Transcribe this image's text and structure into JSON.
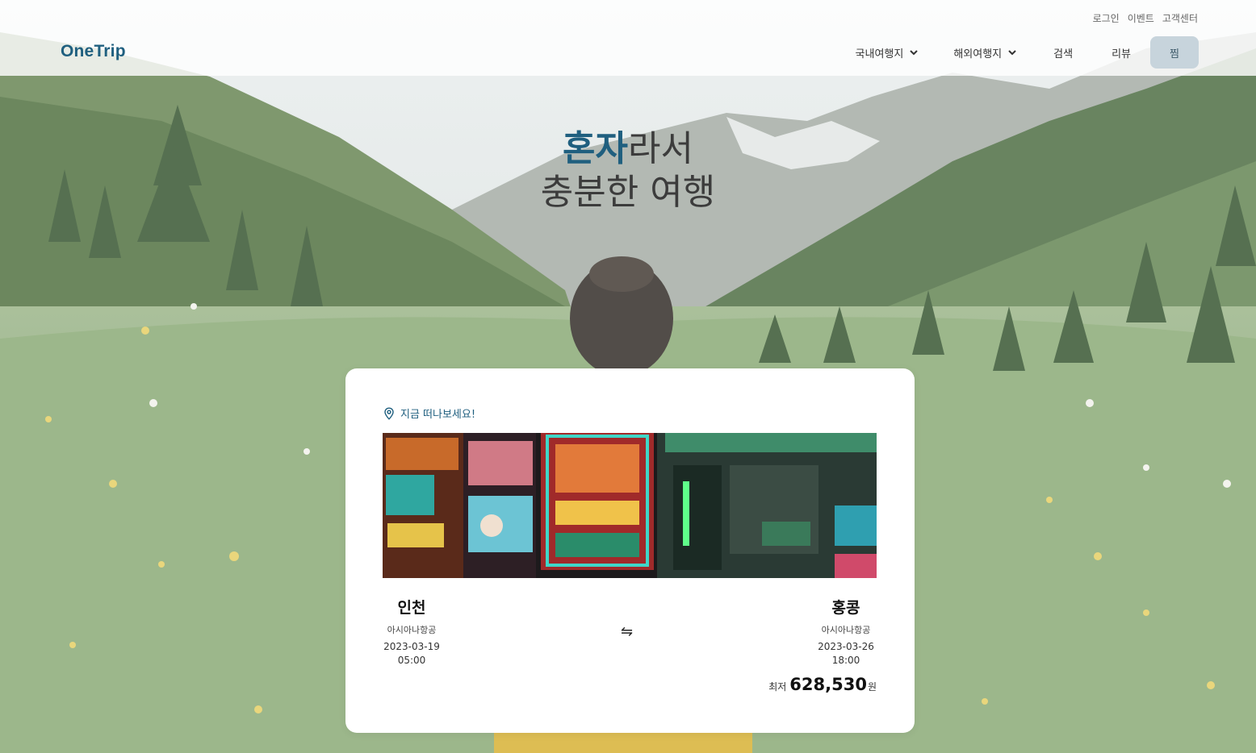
{
  "header": {
    "logo": "OneTrip",
    "utility": [
      "로그인",
      "이벤트",
      "고객센터"
    ],
    "nav": {
      "domestic": "국내여행지",
      "overseas": "해외여행지",
      "search": "검색",
      "review": "리뷰",
      "wishlist": "찜"
    }
  },
  "hero": {
    "line1_accent": "혼자",
    "line1_rest": "라서",
    "line2": "충분한 여행"
  },
  "card": {
    "label": "지금 떠나보세요!",
    "from": {
      "city": "인천",
      "airline": "아시아나항공",
      "date": "2023-03-19",
      "time": "05:00"
    },
    "to": {
      "city": "홍콩",
      "airline": "아시아나항공",
      "date": "2023-03-26",
      "time": "18:00"
    },
    "swap_symbol": "⇋",
    "price_prefix": "최저",
    "price": "628,530",
    "price_unit": "원"
  },
  "colors": {
    "brand": "#1f5f7f",
    "wishlist_button": "#c7d4dc"
  },
  "icons": [
    "chevron-down-icon",
    "location-pin-icon",
    "swap-icon"
  ]
}
